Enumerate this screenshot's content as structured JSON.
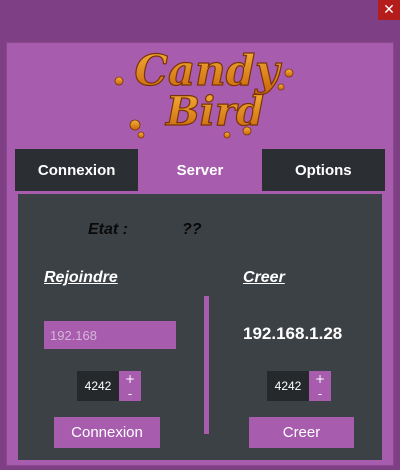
{
  "window": {
    "close_glyph": "✕",
    "close_color": "#b51c1c",
    "background": "#7e3f85",
    "accent": "#a75cad"
  },
  "logo": {
    "line1": "Candy",
    "line2": "Bird",
    "color": "#e08a12"
  },
  "tabs": [
    {
      "label": "Connexion",
      "active": false
    },
    {
      "label": "Server",
      "active": true
    },
    {
      "label": "Options",
      "active": false
    }
  ],
  "status": {
    "label": "Etat :",
    "value": "??"
  },
  "join": {
    "title": "Rejoindre",
    "ip_placeholder": "192.168",
    "port": "4242",
    "plus": "+",
    "minus": "-",
    "button_label": "Connexion"
  },
  "create": {
    "title": "Creer",
    "ip": "192.168.1.28",
    "port": "4242",
    "plus": "+",
    "minus": "-",
    "button_label": "Creer"
  }
}
